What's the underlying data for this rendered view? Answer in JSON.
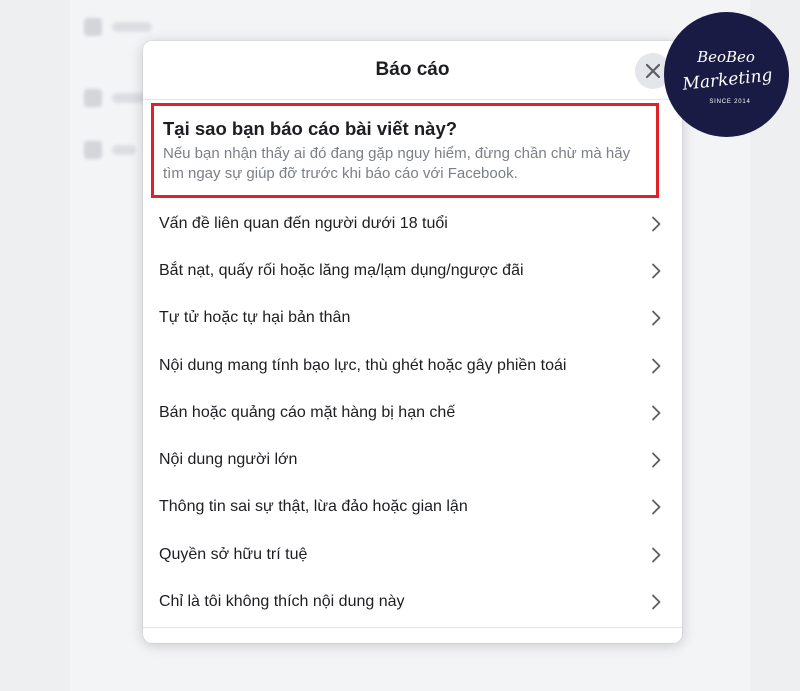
{
  "modal": {
    "title": "Báo cáo",
    "close_icon": "close-icon",
    "intro_heading": "Tại sao bạn báo cáo bài viết này?",
    "intro_description": "Nếu bạn nhận thấy ai đó đang gặp nguy hiểm, đừng chần chừ mà hãy tìm ngay sự giúp đỡ trước khi báo cáo với Facebook.",
    "highlight_color": "#e02127",
    "options": [
      {
        "label": "Vấn đề liên quan đến người dưới 18 tuổi",
        "icon": "chevron-right-icon"
      },
      {
        "label": "Bắt nạt, quấy rối hoặc lăng mạ/lạm dụng/ngược đãi",
        "icon": "chevron-right-icon"
      },
      {
        "label": "Tự tử hoặc tự hại bản thân",
        "icon": "chevron-right-icon"
      },
      {
        "label": "Nội dung mang tính bạo lực, thù ghét hoặc gây phiền toái",
        "icon": "chevron-right-icon"
      },
      {
        "label": "Bán hoặc quảng cáo mặt hàng bị hạn chế",
        "icon": "chevron-right-icon"
      },
      {
        "label": "Nội dung người lớn",
        "icon": "chevron-right-icon"
      },
      {
        "label": "Thông tin sai sự thật, lừa đảo hoặc gian lận",
        "icon": "chevron-right-icon"
      },
      {
        "label": "Quyền sở hữu trí tuệ",
        "icon": "chevron-right-icon"
      },
      {
        "label": "Chỉ là tôi không thích nội dung này",
        "icon": "chevron-right-icon"
      }
    ]
  },
  "watermark": {
    "line1": "BeoBeo",
    "line2": "Marketing",
    "line3": "SINCE 2014",
    "background": "#1a1b44"
  }
}
